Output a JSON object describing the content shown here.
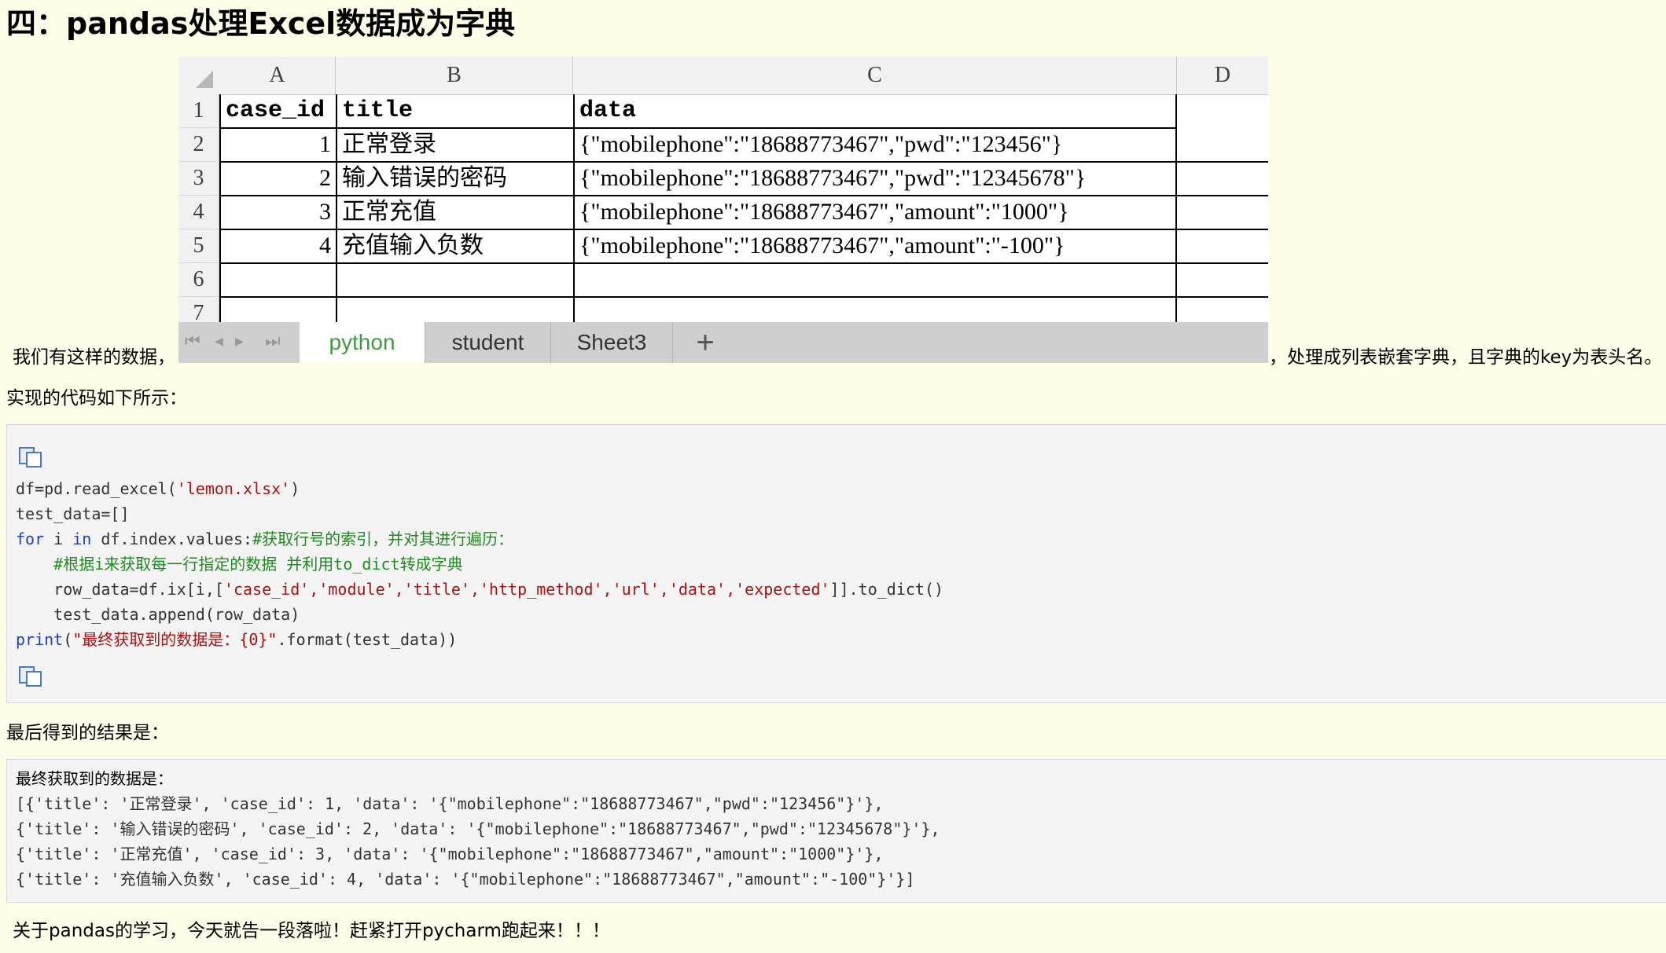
{
  "heading": "四：pandas处理Excel数据成为字典",
  "intro_before": "我们有这样的数据，",
  "intro_after": "，处理成列表嵌套字典，且字典的key为表头名。",
  "code_intro": "实现的代码如下所示：",
  "excel": {
    "col_headers": [
      "A",
      "B",
      "C",
      "D"
    ],
    "row_headers": [
      "1",
      "2",
      "3",
      "4",
      "5",
      "6",
      "7"
    ],
    "header_row": [
      "case_id",
      "title",
      "data"
    ],
    "rows": [
      [
        "1",
        "正常登录",
        "{\"mobilephone\":\"18688773467\",\"pwd\":\"123456\"}"
      ],
      [
        "2",
        "输入错误的密码",
        "{\"mobilephone\":\"18688773467\",\"pwd\":\"12345678\"}"
      ],
      [
        "3",
        "正常充值",
        "{\"mobilephone\":\"18688773467\",\"amount\":\"1000\"}"
      ],
      [
        "4",
        "充值输入负数",
        "{\"mobilephone\":\"18688773467\",\"amount\":\"-100\"}"
      ]
    ],
    "tabs": [
      "python",
      "student",
      "Sheet3",
      "+"
    ],
    "active_tab": "python"
  },
  "code": {
    "line1": "df=pd.read_excel(",
    "line1_str": "'lemon.xlsx'",
    "line1_end": ")",
    "line2": "test_data=[]",
    "line3_kw1": "for",
    "line3_a": " i ",
    "line3_kw2": "in",
    "line3_b": " df.index.values:",
    "line3_comment": "#获取行号的索引，并对其进行遍历：",
    "line4_comment": "    #根据i来获取每一行指定的数据 并利用to_dict转成字典",
    "line5_a": "    row_data=df.ix[i,[",
    "line5_strs": "'case_id','module','title','http_method','url','data','expected'",
    "line5_b": "]].to_dict()",
    "line6": "    test_data.append(row_data)",
    "line7_kw": "print",
    "line7_a": "(",
    "line7_str": "\"最终获取到的数据是：{0}\"",
    "line7_b": ".format(test_data))"
  },
  "result_intro": "最后得到的结果是：",
  "output": {
    "label": "最终获取到的数据是：",
    "lines": [
      "[{'title': '正常登录', 'case_id': 1, 'data': '{\"mobilephone\":\"18688773467\",\"pwd\":\"123456\"}'},",
      "{'title': '输入错误的密码', 'case_id': 2, 'data': '{\"mobilephone\":\"18688773467\",\"pwd\":\"12345678\"}'},",
      "{'title': '正常充值', 'case_id': 3, 'data': '{\"mobilephone\":\"18688773467\",\"amount\":\"1000\"}'},",
      "{'title': '充值输入负数', 'case_id': 4, 'data': '{\"mobilephone\":\"18688773467\",\"amount\":\"-100\"}'}]"
    ]
  },
  "closing": "关于pandas的学习，今天就告一段落啦！赶紧打开pycharm跑起来！！！"
}
